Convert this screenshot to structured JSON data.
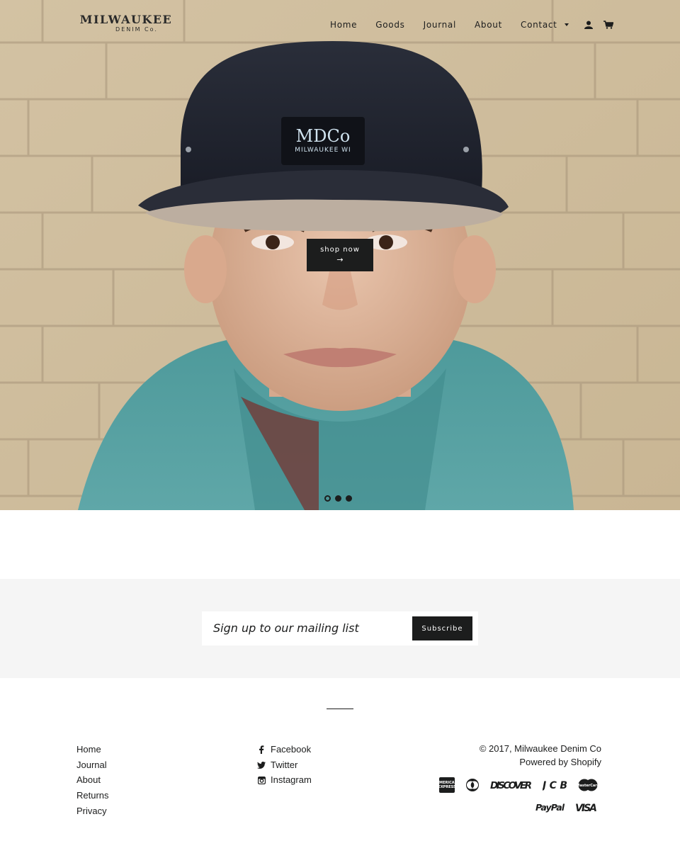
{
  "header": {
    "logo": {
      "main": "MILWAUKEE",
      "sub": "DENIM Co."
    },
    "nav": [
      {
        "label": "Home"
      },
      {
        "label": "Goods"
      },
      {
        "label": "Journal"
      },
      {
        "label": "About"
      },
      {
        "label": "Contact",
        "has_dropdown": true
      }
    ],
    "icons": [
      "account-icon",
      "cart-icon"
    ]
  },
  "hero": {
    "photo": "boy-in-denim-cap-photo",
    "cap_patch": {
      "main": "MDCo",
      "sub": "MILWAUKEE WI"
    },
    "cta_label": "shop now",
    "cta_arrow": "→",
    "slides_total": 3,
    "slide_active": 1
  },
  "newsletter": {
    "placeholder": "Sign up to our mailing list",
    "value": "",
    "button_label": "Subscribe"
  },
  "footer": {
    "links": [
      "Home",
      "Journal",
      "About",
      "Returns",
      "Privacy"
    ],
    "social": [
      {
        "label": "Facebook",
        "icon": "facebook-icon"
      },
      {
        "label": "Twitter",
        "icon": "twitter-icon"
      },
      {
        "label": "Instagram",
        "icon": "instagram-icon"
      }
    ],
    "copyright": "© 2017, Milwaukee Denim Co",
    "powered": "Powered by Shopify",
    "payments": [
      "American Express",
      "Diners Club",
      "DISCOVER",
      "JCB",
      "MasterCard",
      "PayPal",
      "VISA"
    ]
  },
  "colors": {
    "accent": "#1c1d1d",
    "newsletter_bg": "#f5f5f5",
    "wall": "#d9c7a8"
  }
}
